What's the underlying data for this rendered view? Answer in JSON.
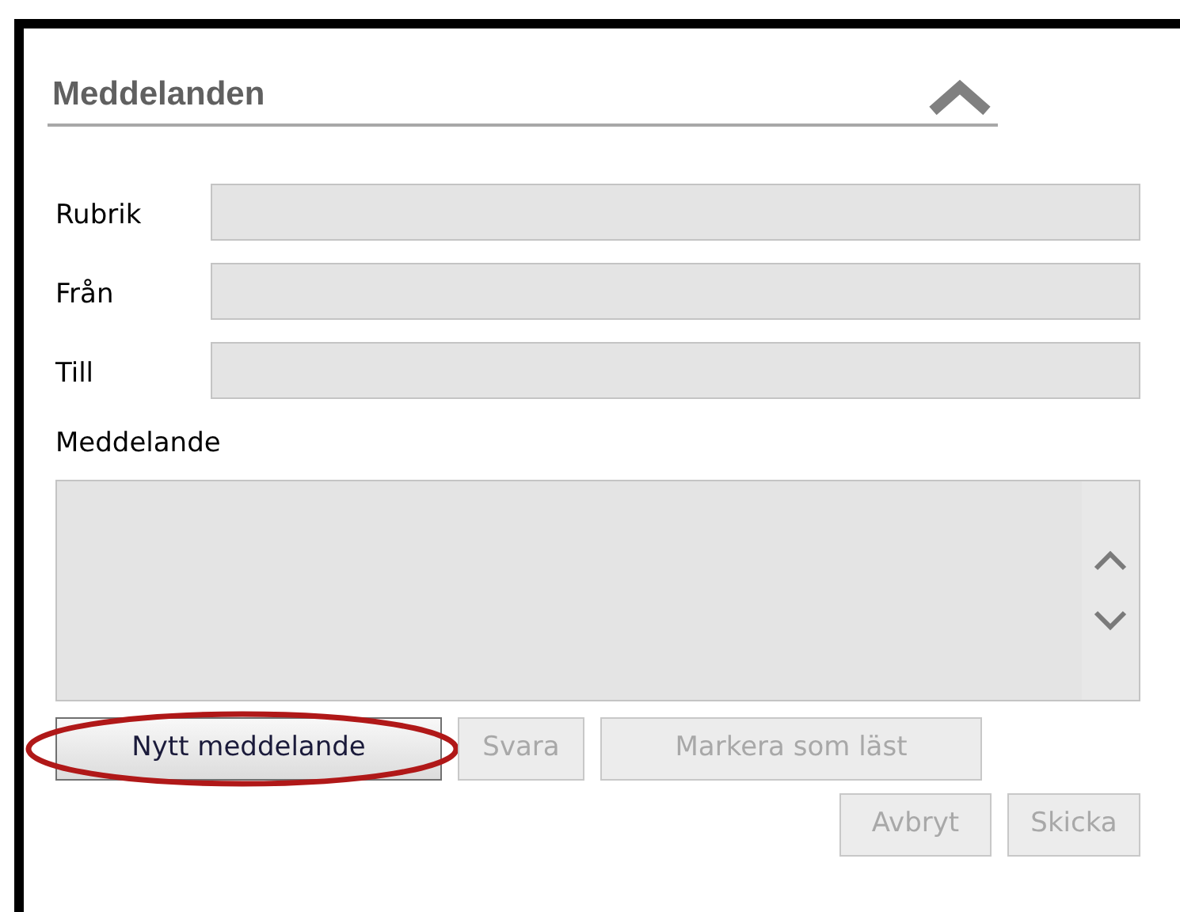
{
  "panel": {
    "title": "Meddelanden",
    "expanded": true
  },
  "fields": [
    {
      "label": "Rubrik"
    },
    {
      "label": "Från"
    },
    {
      "label": "Till"
    }
  ],
  "message": {
    "label": "Meddelande"
  },
  "buttons": [
    {
      "label": "Nytt meddelande",
      "disabled": false,
      "highlighted": true
    },
    {
      "label": "Svara",
      "disabled": true,
      "highlighted": false
    },
    {
      "label": "Markera som läst",
      "disabled": true,
      "highlighted": false
    }
  ],
  "footer_buttons": [
    {
      "label": "Avbryt",
      "disabled": true
    },
    {
      "label": "Skicka",
      "disabled": true
    }
  ]
}
